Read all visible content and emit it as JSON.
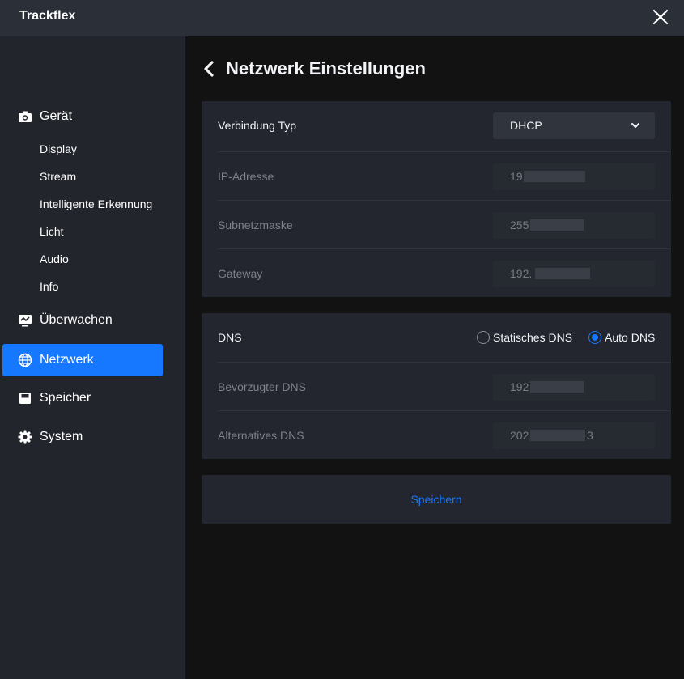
{
  "app": {
    "title": "Trackflex"
  },
  "titlebar": {
    "close_icon": "close-icon"
  },
  "sidebar": {
    "groups": [
      {
        "label": "Gerät",
        "icon": "camera-icon"
      },
      {
        "label": "Überwachen",
        "icon": "monitor-icon"
      },
      {
        "label": "Netzwerk",
        "icon": "globe-icon"
      },
      {
        "label": "Speicher",
        "icon": "storage-icon"
      },
      {
        "label": "System",
        "icon": "gear-icon"
      }
    ],
    "sub_items": [
      "Display",
      "Stream",
      "Intelligente Erkennung",
      "Licht",
      "Audio",
      "Info"
    ],
    "active": "Netzwerk",
    "active_color": "#1677ff"
  },
  "page": {
    "title": "Netzwerk Einstellungen",
    "back_icon": "chevron-left-icon"
  },
  "connection": {
    "type_label": "Verbindung Typ",
    "type_value": "DHCP",
    "ip_label": "IP-Adresse",
    "ip_value": "19",
    "subnet_label": "Subnetzmaske",
    "subnet_value": "255",
    "gateway_label": "Gateway",
    "gateway_value": "192."
  },
  "dns": {
    "label": "DNS",
    "options": [
      "Statisches DNS",
      "Auto DNS"
    ],
    "selected": "Auto DNS",
    "preferred_label": "Bevorzugter DNS",
    "preferred_value": "192",
    "alternative_label": "Alternatives DNS",
    "alternative_value_start": "202",
    "alternative_value_end": "3"
  },
  "actions": {
    "save_label": "Speichern"
  }
}
